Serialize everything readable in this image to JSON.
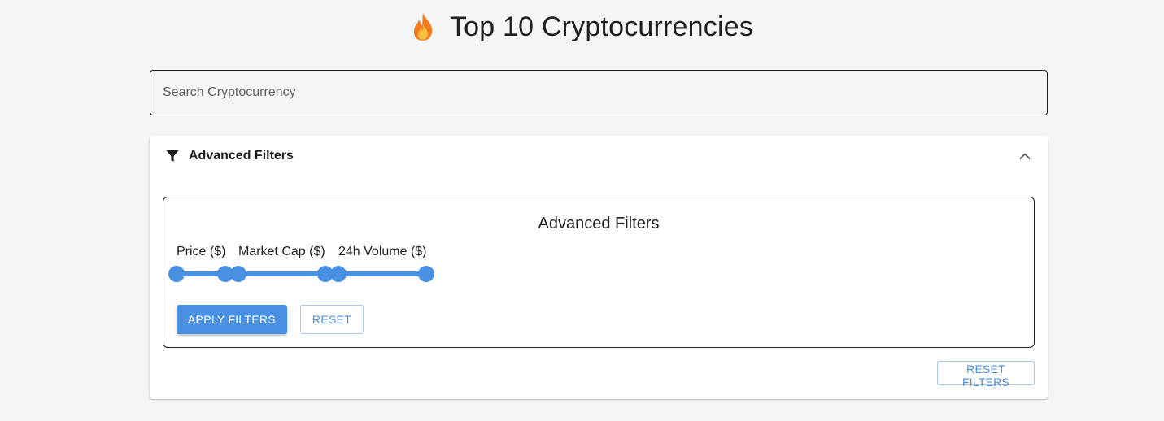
{
  "header": {
    "title": "Top 10 Cryptocurrencies",
    "icon": "fire-icon"
  },
  "search": {
    "placeholder": "Search Cryptocurrency",
    "value": ""
  },
  "accordion": {
    "title": "Advanced Filters",
    "icon": "funnel-icon",
    "expanded": true
  },
  "filters_panel": {
    "title": "Advanced Filters",
    "sliders": [
      {
        "label": "Price ($)"
      },
      {
        "label": "Market Cap ($)"
      },
      {
        "label": "24h Volume ($)"
      }
    ],
    "apply_label": "APPLY FILTERS",
    "reset_label": "RESET"
  },
  "reset_filters_label": "RESET FILTERS",
  "colors": {
    "accent": "#4a90e2",
    "background": "#f4f5f7",
    "fire_outer": "#f47b20",
    "fire_inner": "#fcc13d"
  }
}
